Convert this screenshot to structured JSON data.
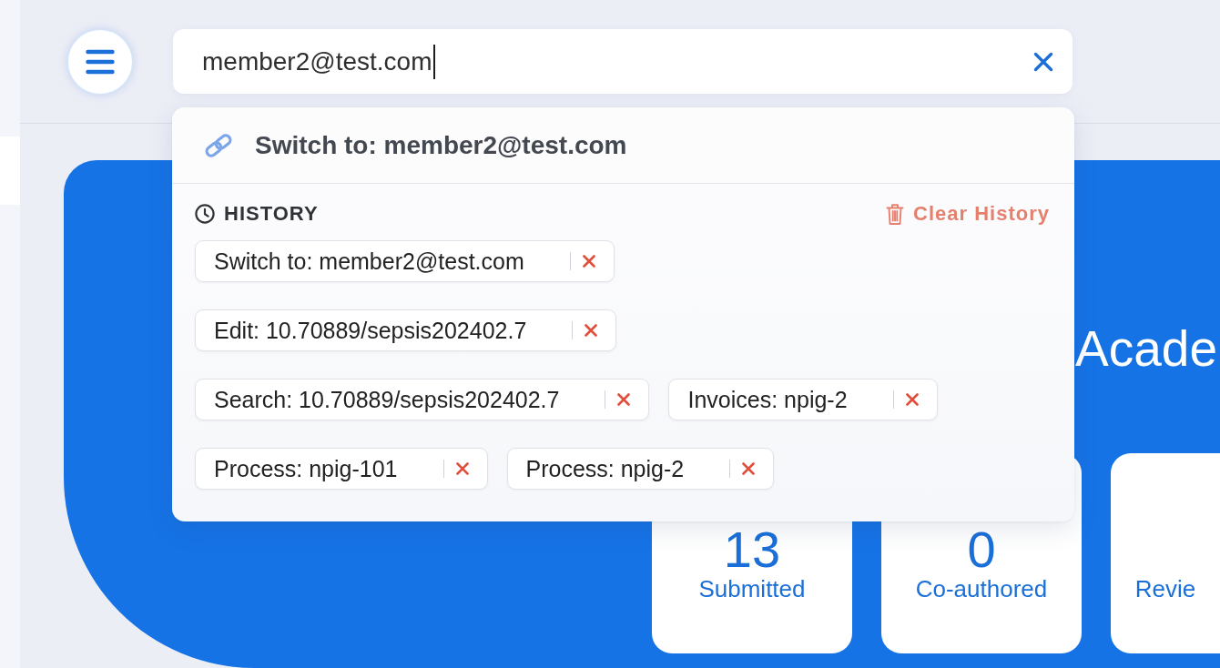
{
  "search": {
    "value": "member2@test.com"
  },
  "dropdown": {
    "suggestions": [
      {
        "label": "Switch to: member2@test.com"
      }
    ],
    "history": {
      "heading": "HISTORY",
      "clear_label": "Clear History",
      "items": [
        {
          "label": "Switch to: member2@test.com"
        },
        {
          "label": "Edit: 10.70889/sepsis202402.7"
        },
        {
          "label": "Search: 10.70889/sepsis202402.7"
        },
        {
          "label": "Invoices: npig-2"
        },
        {
          "label": "Process: npig-101"
        },
        {
          "label": "Process: npig-2"
        }
      ]
    }
  },
  "hero": {
    "title": "Acade"
  },
  "stats": [
    {
      "value": "13",
      "label": "Submitted"
    },
    {
      "value": "0",
      "label": "Co-authored"
    },
    {
      "label": "Revie"
    }
  ]
}
